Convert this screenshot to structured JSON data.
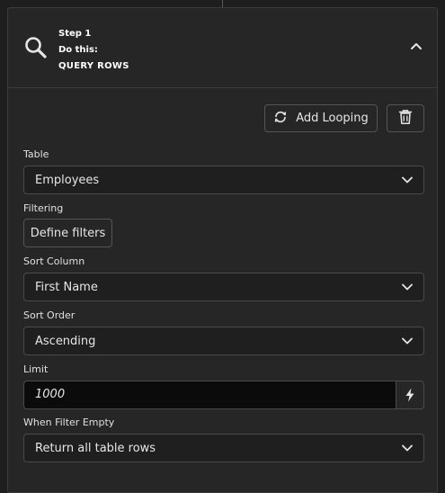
{
  "step": {
    "number_label": "Step 1",
    "do_label": "Do this:",
    "action_label": "QUERY ROWS",
    "icon": "search-icon",
    "collapse_icon": "chevron-up-icon"
  },
  "toolbar": {
    "looping_label": "Add Looping",
    "looping_icon": "loop-icon",
    "delete_icon": "trash-icon"
  },
  "fields": {
    "table": {
      "label": "Table",
      "value": "Employees"
    },
    "filtering": {
      "label": "Filtering",
      "button_label": "Define filters"
    },
    "sort_column": {
      "label": "Sort Column",
      "value": "First Name"
    },
    "sort_order": {
      "label": "Sort Order",
      "value": "Ascending"
    },
    "limit": {
      "label": "Limit",
      "value": "1000",
      "toggle_icon": "lightning-bolt-icon"
    },
    "when_filter_empty": {
      "label": "When Filter Empty",
      "value": "Return all table rows"
    }
  },
  "colors": {
    "background": "#1e1e1e",
    "panel": "#262626",
    "border": "#3c3c3c",
    "input_dark": "#0b0b0b",
    "text": "#e6e6e6"
  }
}
